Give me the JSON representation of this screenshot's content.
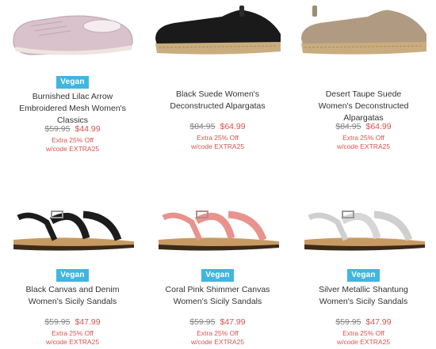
{
  "products": [
    {
      "badge": "Vegan",
      "name": "Burnished Lilac Arrow Embroidered Mesh Women's Classics",
      "old_price": "$59.95",
      "new_price": "$44.99",
      "promo_line1": "Extra 25% Off",
      "promo_line2": "w/code EXTRA25",
      "color": "#d9c2cb",
      "icon": "slip-on-shoe-icon"
    },
    {
      "badge": "",
      "name": "Black Suede Women's Deconstructed Alpargatas",
      "old_price": "$84.95",
      "new_price": "$64.99",
      "promo_line1": "Extra 25% Off",
      "promo_line2": "w/code EXTRA25",
      "color": "#1a1a1a",
      "icon": "espadrille-shoe-icon"
    },
    {
      "badge": "",
      "name": "Desert Taupe Suede Women's Deconstructed Alpargatas",
      "old_price": "$84.95",
      "new_price": "$64.99",
      "promo_line1": "Extra 25% Off",
      "promo_line2": "w/code EXTRA25",
      "color": "#b09b82",
      "icon": "espadrille-shoe-icon"
    },
    {
      "badge": "Vegan",
      "name": "Black Canvas and Denim Women's Sicily Sandals",
      "old_price": "$59.95",
      "new_price": "$47.99",
      "promo_line1": "Extra 25% Off",
      "promo_line2": "w/code EXTRA25",
      "color": "#1c1c1c",
      "icon": "sandal-icon"
    },
    {
      "badge": "Vegan",
      "name": "Coral Pink Shimmer Canvas Women's Sicily Sandals",
      "old_price": "$59.95",
      "new_price": "$47.99",
      "promo_line1": "Extra 25% Off",
      "promo_line2": "w/code EXTRA25",
      "color": "#e8938e",
      "icon": "sandal-icon"
    },
    {
      "badge": "Vegan",
      "name": "Silver Metallic Shantung Women's Sicily Sandals",
      "old_price": "$59.95",
      "new_price": "$47.99",
      "promo_line1": "Extra 25% Off",
      "promo_line2": "w/code EXTRA25",
      "color": "#cfcfcf",
      "icon": "sandal-icon"
    }
  ]
}
